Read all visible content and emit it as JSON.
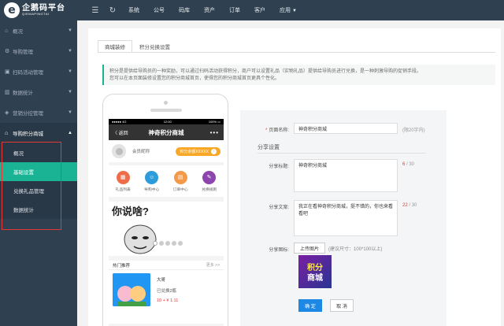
{
  "brand": {
    "name_cn": "企鹅码平台",
    "name_en": "QIEMAPINGTAI",
    "mark": "e"
  },
  "topnav": {
    "items": [
      "系统",
      "公号",
      "码库",
      "资产",
      "订单",
      "客户",
      "应用"
    ]
  },
  "sidebar": {
    "items": [
      {
        "label": "概况"
      },
      {
        "label": "导购管理"
      },
      {
        "label": "扫码活动管理"
      },
      {
        "label": "数据统计"
      },
      {
        "label": "营销分控管理"
      },
      {
        "label": "导购积分商城"
      }
    ],
    "sub_items": [
      {
        "label": "概况"
      },
      {
        "label": "基础设置"
      },
      {
        "label": "兑换礼品管理"
      },
      {
        "label": "数据统计"
      }
    ]
  },
  "tabs": [
    {
      "label": "商城装修"
    },
    {
      "label": "积分兑换设置"
    }
  ],
  "notice": {
    "line1": "积分是提供给导购员的一种奖励，可以通过扫码活动获得积分，商户可以设置礼品（实物礼品）提供给导购员进行兑换，是一种刺激导购的促销手段。",
    "line2": "您可以在本页面装修设置您的积分商城首页，使得您的积分商城首页更具个性化。"
  },
  "phone": {
    "status_left": "●●●●● 4G",
    "status_time": "12:00",
    "status_right": "100% ▭",
    "back_label": "〈 返回",
    "title": "神奇积分商城",
    "dots": "•••",
    "member_name": "会员昵称",
    "points_label": "积分余额XXXXX",
    "points_arrow": "›",
    "quick": [
      {
        "label": "礼品列表",
        "icon": "gift-icon",
        "color": "#ef6c4a",
        "glyph": "▦"
      },
      {
        "label": "导购中心",
        "icon": "user-icon",
        "color": "#2d9cdb",
        "glyph": "☺"
      },
      {
        "label": "订单中心",
        "icon": "order-icon",
        "color": "#f2994a",
        "glyph": "▤"
      },
      {
        "label": "兑换规则",
        "icon": "rule-icon",
        "color": "#8e44ad",
        "glyph": "✎"
      }
    ],
    "banner_text": "你说啥?",
    "hot_title": "热门推荐",
    "hot_more": "更多 >>",
    "product": {
      "name": "大哥",
      "exchanged": "已兑换2瓶",
      "price": "10 + ¥ 1.11"
    }
  },
  "form": {
    "page_name_label": "页面名称:",
    "page_name_value": "神奇积分商城",
    "page_name_hint": "(限20字内)",
    "share_section": "分享设置",
    "share_title_label": "分享标题:",
    "share_title_value": "神奇积分商城",
    "share_title_count": "6",
    "share_title_max": "/ 30",
    "share_text_label": "分享文案:",
    "share_text_value": "我正在看神奇积分商城，挺不错的，你也来看看吧",
    "share_text_count": "22",
    "share_text_max": "/ 30",
    "share_icon_label": "分享图标:",
    "upload_label": "上传图片",
    "size_note": "(建议尺寸：100*100以上)",
    "thumb_text": "积分商城",
    "ok_label": "确 定",
    "cancel_label": "取 消"
  }
}
